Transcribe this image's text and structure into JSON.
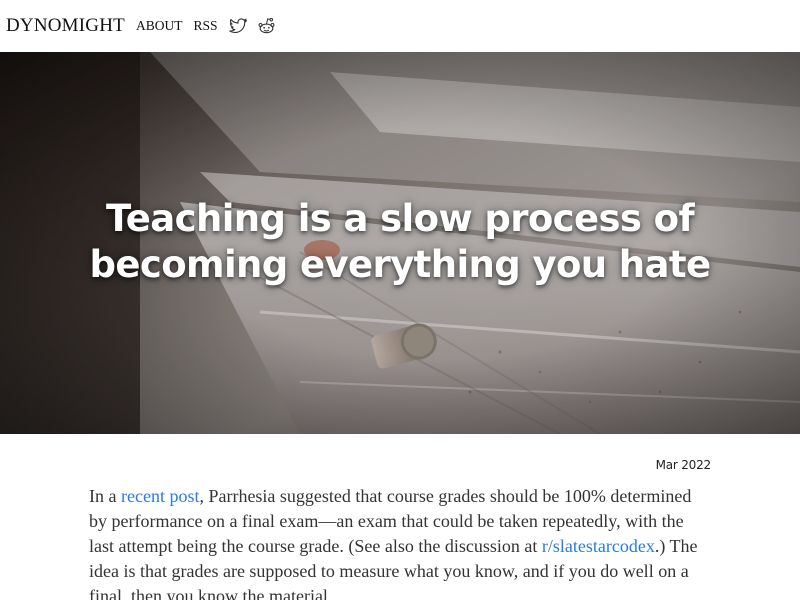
{
  "nav": {
    "brand": "DYNOMIGHT",
    "about": "ABOUT",
    "rss": "RSS",
    "twitter_icon": "twitter-icon",
    "reddit_icon": "reddit-icon"
  },
  "hero": {
    "title_line1": "Teaching is a slow process of",
    "title_line2": "becoming everything you hate"
  },
  "article": {
    "date": "Mar 2022",
    "p1_a": "In a ",
    "p1_link1": "recent post",
    "p1_b": ", Parrhesia suggested that course grades should be 100% determined by performance on a final exam—an exam that could be taken repeatedly, with the last attempt being the course grade. (See also the discussion at ",
    "p1_link2": "r/slatestarcodex",
    "p1_c": ".) The idea is that grades are supposed to measure what you know, and if you do well on a final, then you know the material."
  },
  "colors": {
    "link": "#2a7ae2",
    "text": "#333333",
    "hero_text": "#ffffff"
  }
}
